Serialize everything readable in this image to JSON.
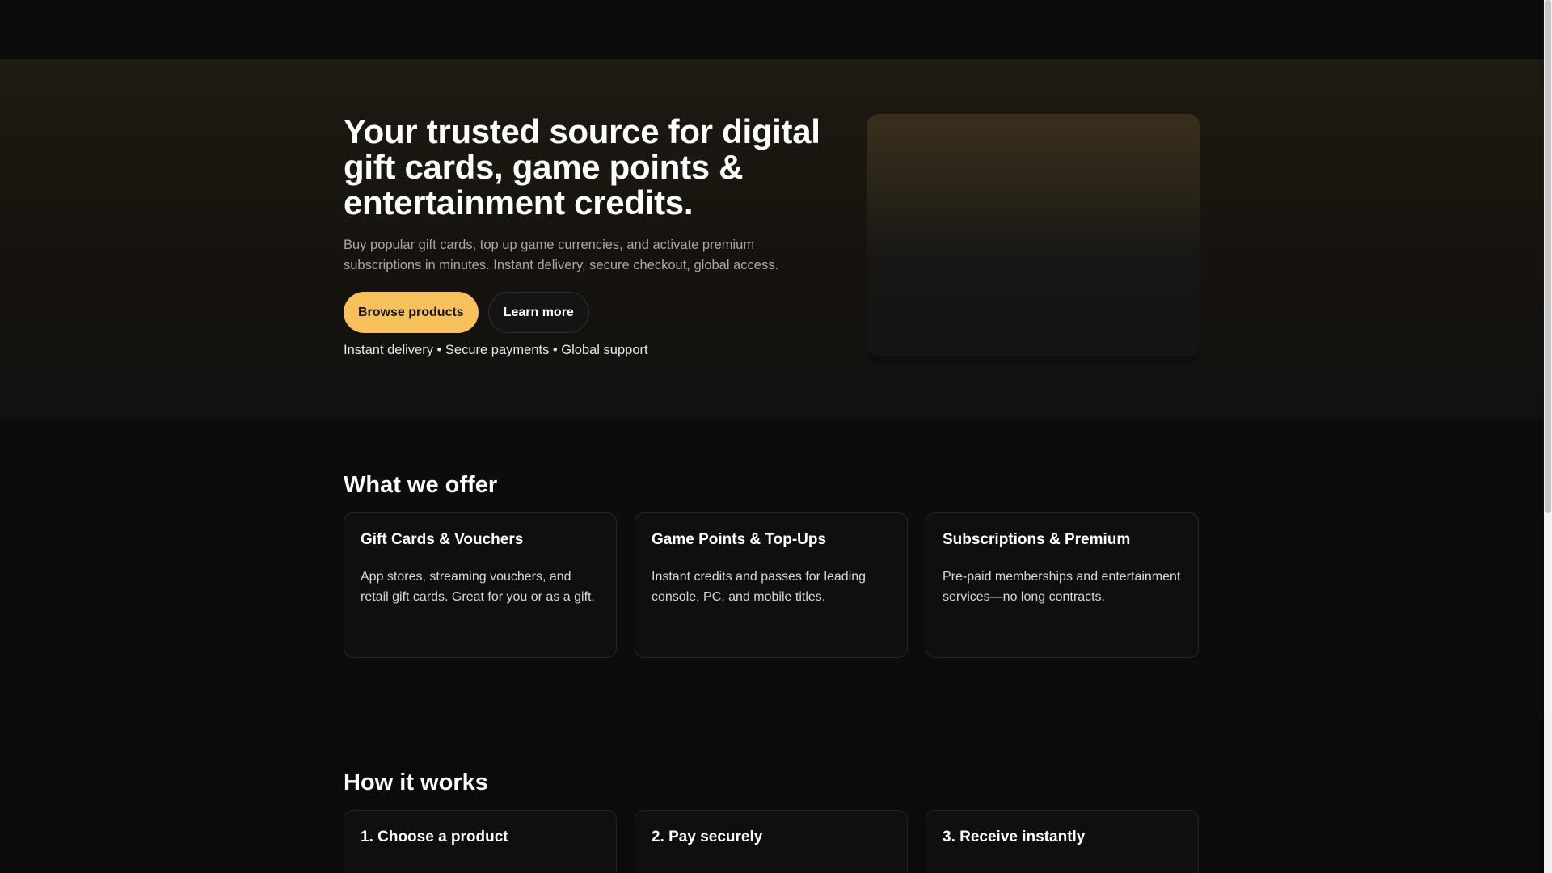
{
  "hero": {
    "title": "Your trusted source for digital gift cards, game points & entertainment credits.",
    "subtitle": "Buy popular gift cards, top up game currencies, and activate premium subscriptions in minutes. Instant delivery, secure checkout, global access.",
    "primary_button": "Browse products",
    "secondary_button": "Learn more",
    "features": "Instant delivery • Secure payments • Global support"
  },
  "offer": {
    "title": "What we offer",
    "cards": [
      {
        "title": "Gift Cards & Vouchers",
        "text": "App stores, streaming vouchers, and retail gift cards. Great for you or as a gift."
      },
      {
        "title": "Game Points & Top-Ups",
        "text": "Instant credits and passes for leading console, PC, and mobile titles."
      },
      {
        "title": "Subscriptions & Premium",
        "text": "Pre-paid memberships and entertainment services—no long contracts."
      }
    ]
  },
  "how": {
    "title": "How it works",
    "cards": [
      {
        "title": "1. Choose a product"
      },
      {
        "title": "2. Pay securely"
      },
      {
        "title": "3. Receive instantly"
      }
    ]
  },
  "colors": {
    "accent": "#f6c15a",
    "background": "#0b0b0b",
    "card_border": "#262626"
  }
}
